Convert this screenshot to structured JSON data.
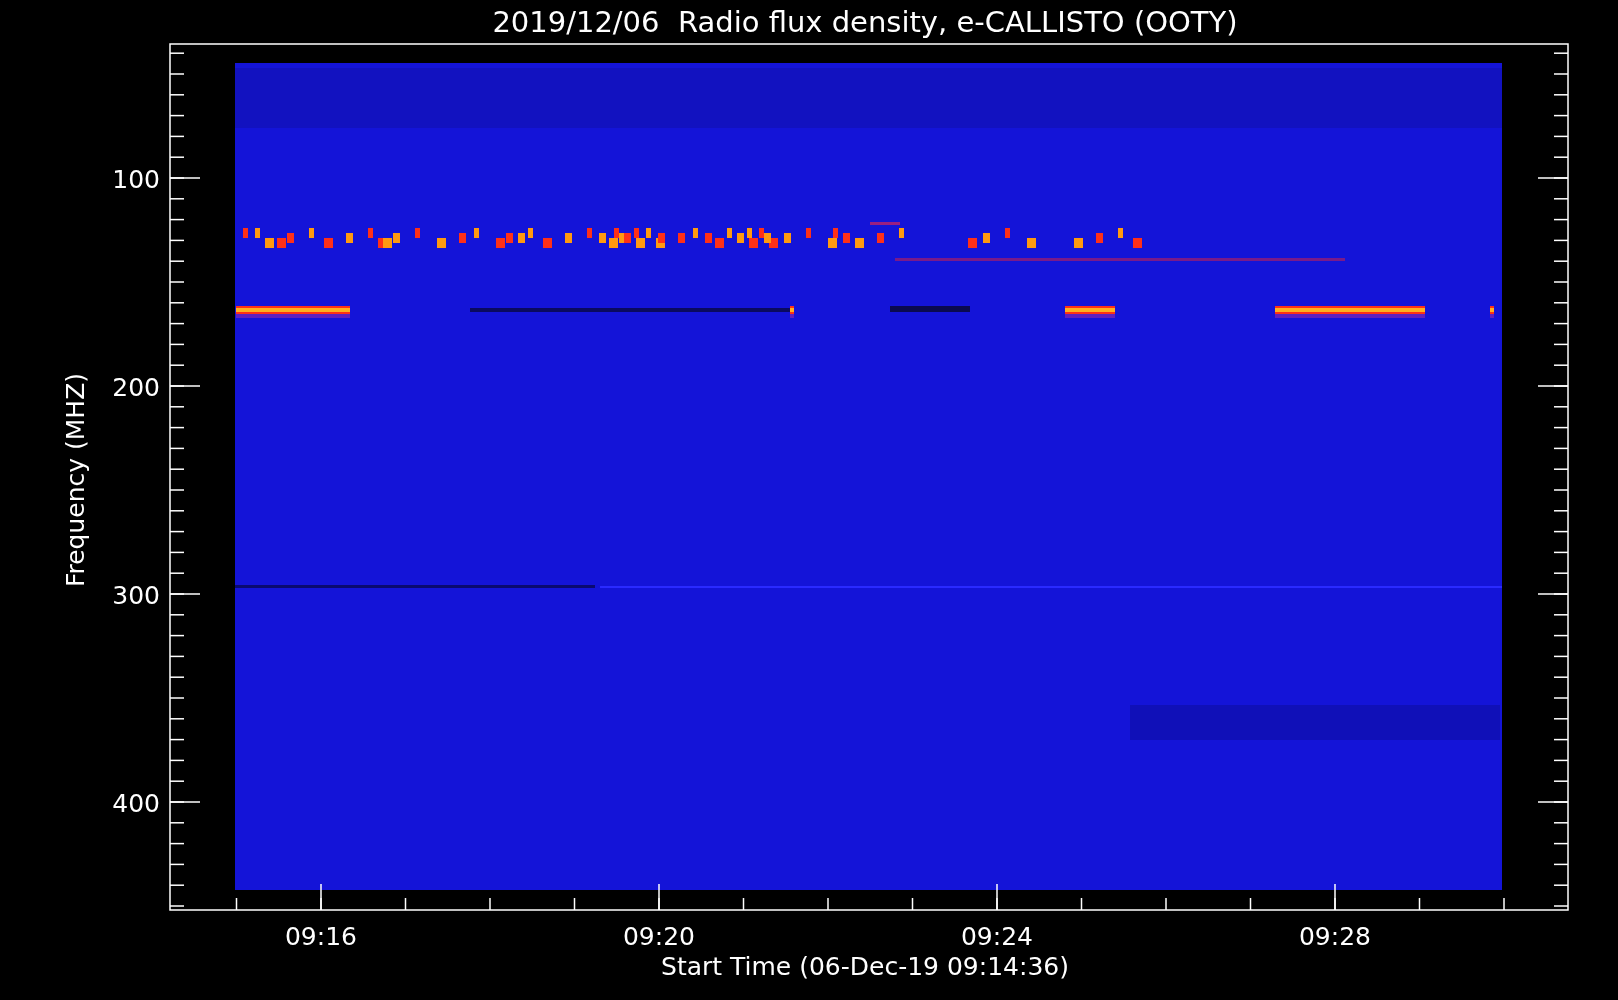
{
  "title": "2019/12/06  Radio flux density, e-CALLISTO (OOTY)",
  "y_axis": {
    "label": "Frequency (MHZ)",
    "ticks": [
      "100",
      "200",
      "300",
      "400"
    ]
  },
  "x_axis": {
    "label": "Start Time (06-Dec-19 09:14:36)",
    "ticks": [
      "09:16",
      "09:20",
      "09:24",
      "09:28"
    ]
  }
}
